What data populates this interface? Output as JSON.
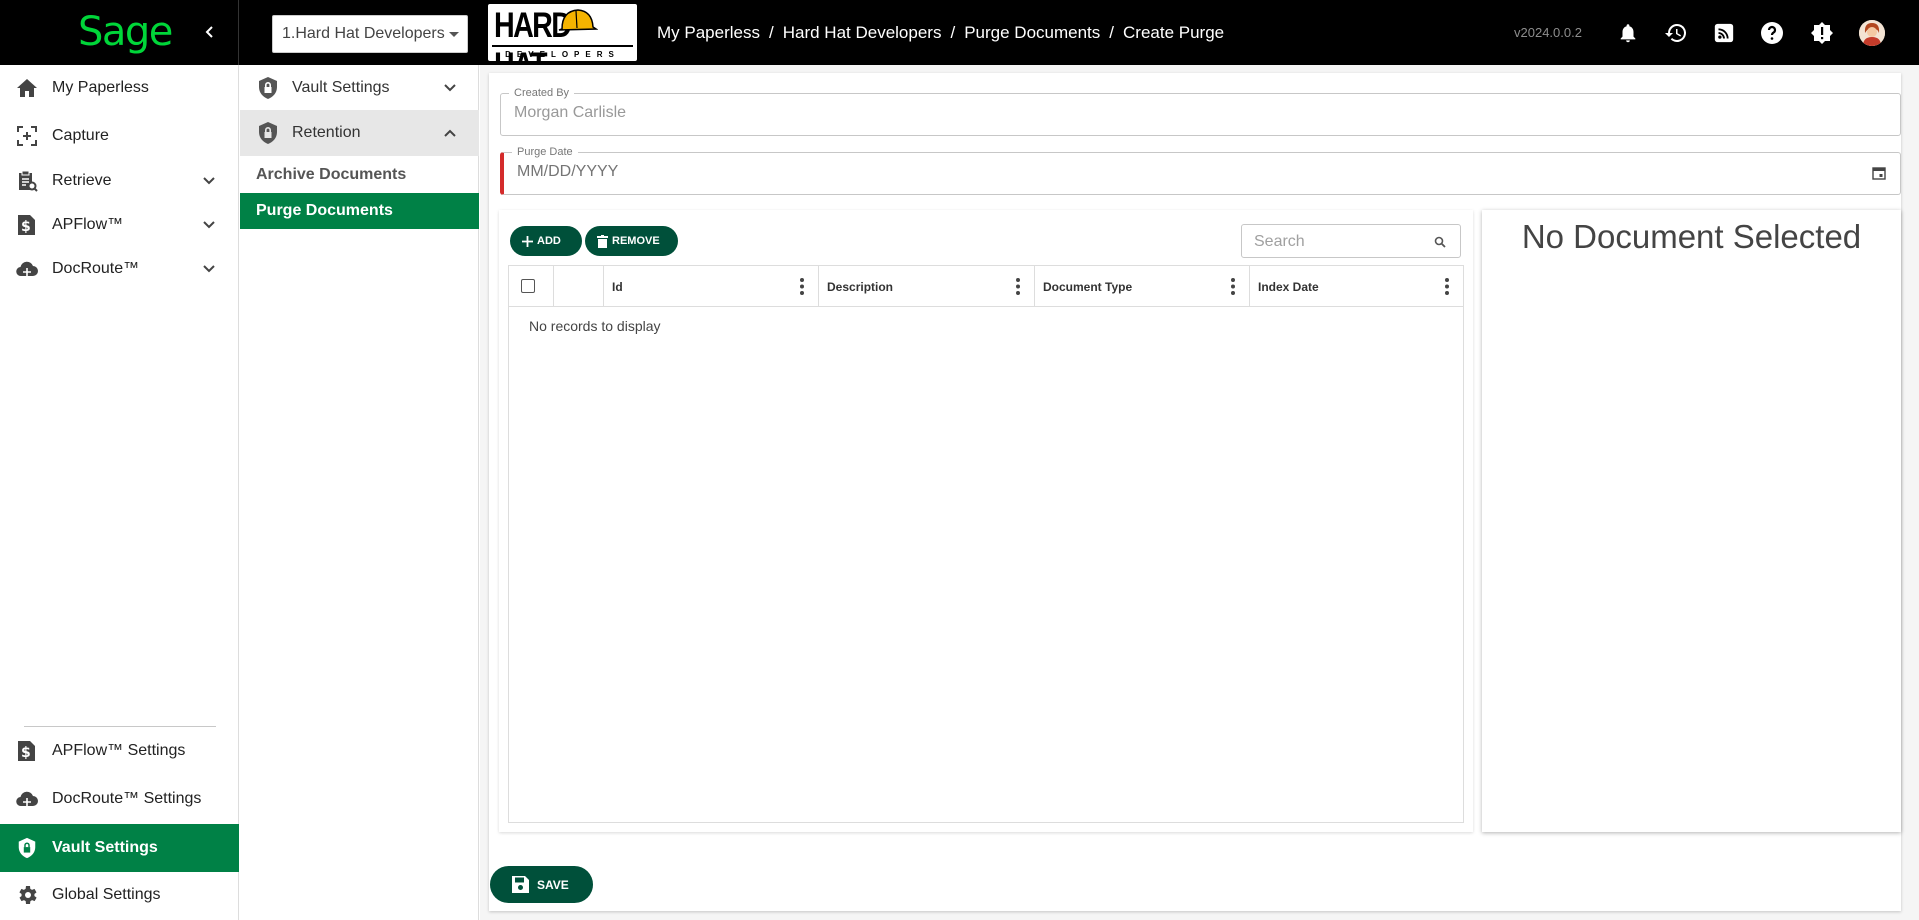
{
  "app": {
    "brand": "Sage",
    "company_select": "1.Hard Hat Developers",
    "company_logo": {
      "main": "HARD HAT",
      "sub": "DEVELOPERS"
    },
    "breadcrumb": [
      "My Paperless",
      "Hard Hat Developers",
      "Purge Documents",
      "Create Purge"
    ],
    "breadcrumb_sep": "/",
    "version": "v2024.0.0.2",
    "icons": [
      "bell-icon",
      "history-icon",
      "rss-icon",
      "help-icon",
      "alert-icon",
      "avatar"
    ]
  },
  "sidebar": {
    "items": [
      {
        "label": "My Paperless",
        "icon": "home-icon"
      },
      {
        "label": "Capture",
        "icon": "capture-icon"
      },
      {
        "label": "Retrieve",
        "icon": "retrieve-icon"
      },
      {
        "label": "APFlow™",
        "icon": "dollar-doc-icon"
      },
      {
        "label": "DocRoute™",
        "icon": "cloud-icon"
      }
    ],
    "settings": [
      {
        "label": "APFlow™ Settings",
        "icon": "dollar-doc-icon"
      },
      {
        "label": "DocRoute™ Settings",
        "icon": "cloud-icon"
      },
      {
        "label": "Vault Settings",
        "icon": "shield-icon"
      },
      {
        "label": "Global Settings",
        "icon": "gear-icon"
      }
    ]
  },
  "subnav": {
    "sections": [
      {
        "label": "Vault Settings"
      },
      {
        "label": "Retention"
      }
    ],
    "links": [
      "Archive Documents",
      "Purge Documents"
    ]
  },
  "form": {
    "created_by_label": "Created By",
    "created_by_value": "Morgan Carlisle",
    "purge_date_label": "Purge Date",
    "purge_date_placeholder": "MM/DD/YYYY"
  },
  "grid": {
    "add_label": "ADD",
    "remove_label": "REMOVE",
    "search_placeholder": "Search",
    "columns": [
      "Id",
      "Description",
      "Document Type",
      "Index Date"
    ],
    "empty_text": "No records to display"
  },
  "preview": {
    "title": "No Document Selected"
  },
  "footer": {
    "save_label": "SAVE"
  },
  "colors": {
    "accent": "#008146",
    "button": "#00503a",
    "brand": "#00d639",
    "required": "#d42b2b"
  }
}
